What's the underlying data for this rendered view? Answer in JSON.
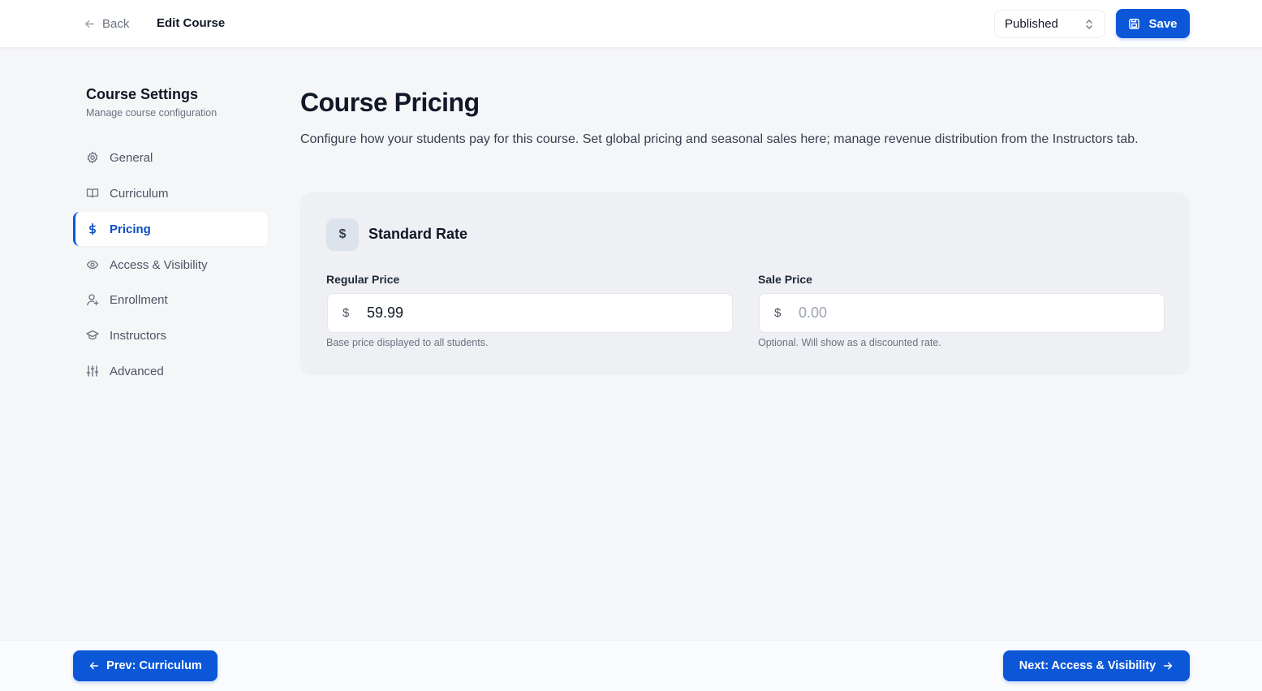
{
  "header": {
    "back_label": "Back",
    "title": "Edit Course",
    "status": "Published",
    "save_label": "Save"
  },
  "sidebar": {
    "title": "Course Settings",
    "subtitle": "Manage course configuration",
    "items": [
      {
        "label": "General",
        "icon": "gear-icon"
      },
      {
        "label": "Curriculum",
        "icon": "book-icon"
      },
      {
        "label": "Pricing",
        "icon": "dollar-icon",
        "active": true
      },
      {
        "label": "Access & Visibility",
        "icon": "eye-icon"
      },
      {
        "label": "Enrollment",
        "icon": "user-plus-icon"
      },
      {
        "label": "Instructors",
        "icon": "graduation-cap-icon"
      },
      {
        "label": "Advanced",
        "icon": "sliders-icon"
      }
    ]
  },
  "main": {
    "title": "Course Pricing",
    "description": "Configure how your students pay for this course. Set global pricing and seasonal sales here; manage revenue distribution from the Instructors tab.",
    "card": {
      "icon_glyph": "$",
      "title": "Standard Rate",
      "regular": {
        "label": "Regular Price",
        "currency": "$",
        "value": "59.99",
        "help": "Base price displayed to all students."
      },
      "sale": {
        "label": "Sale Price",
        "currency": "$",
        "value": "",
        "placeholder": "0.00",
        "help": "Optional. Will show as a discounted rate."
      }
    }
  },
  "footer": {
    "prev_label": "Prev: Curriculum",
    "next_label": "Next: Access & Visibility"
  },
  "colors": {
    "accent": "#0b57d8",
    "active_text": "#0b4fc4",
    "background": "#f5f6f8"
  }
}
